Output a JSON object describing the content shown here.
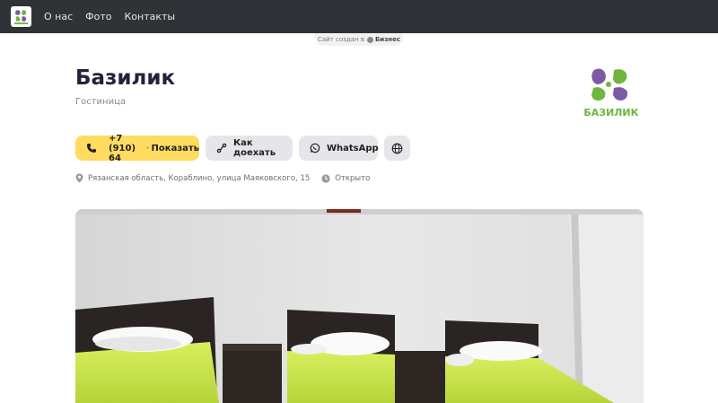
{
  "nav": {
    "logo_icon": "basilik-logo-icon",
    "items": [
      {
        "label": "О нас"
      },
      {
        "label": "Фото"
      },
      {
        "label": "Контакты"
      }
    ]
  },
  "made_with": {
    "prefix": "Сайт создан в",
    "brand": "Бизнес"
  },
  "header": {
    "title": "Базилик",
    "subtitle": "Гостиница",
    "logo_text": "БАЗИЛИК"
  },
  "actions": {
    "phone_visible": "+7 (910) 64",
    "phone_fade": "·",
    "phone_show": "Показать",
    "route": "Как доехать",
    "whatsapp": "WhatsApp"
  },
  "meta": {
    "address": "Рязанская область, Кораблино, улица Маяковского, 15",
    "status": "Открыто"
  },
  "colors": {
    "topbar": "#2f3237",
    "phone_button": "#ffdc60",
    "secondary_button": "#e4e6ea",
    "logo_green": "#6fb53f",
    "logo_purple": "#7b5aa6",
    "bedspread": "#c8e64a"
  }
}
